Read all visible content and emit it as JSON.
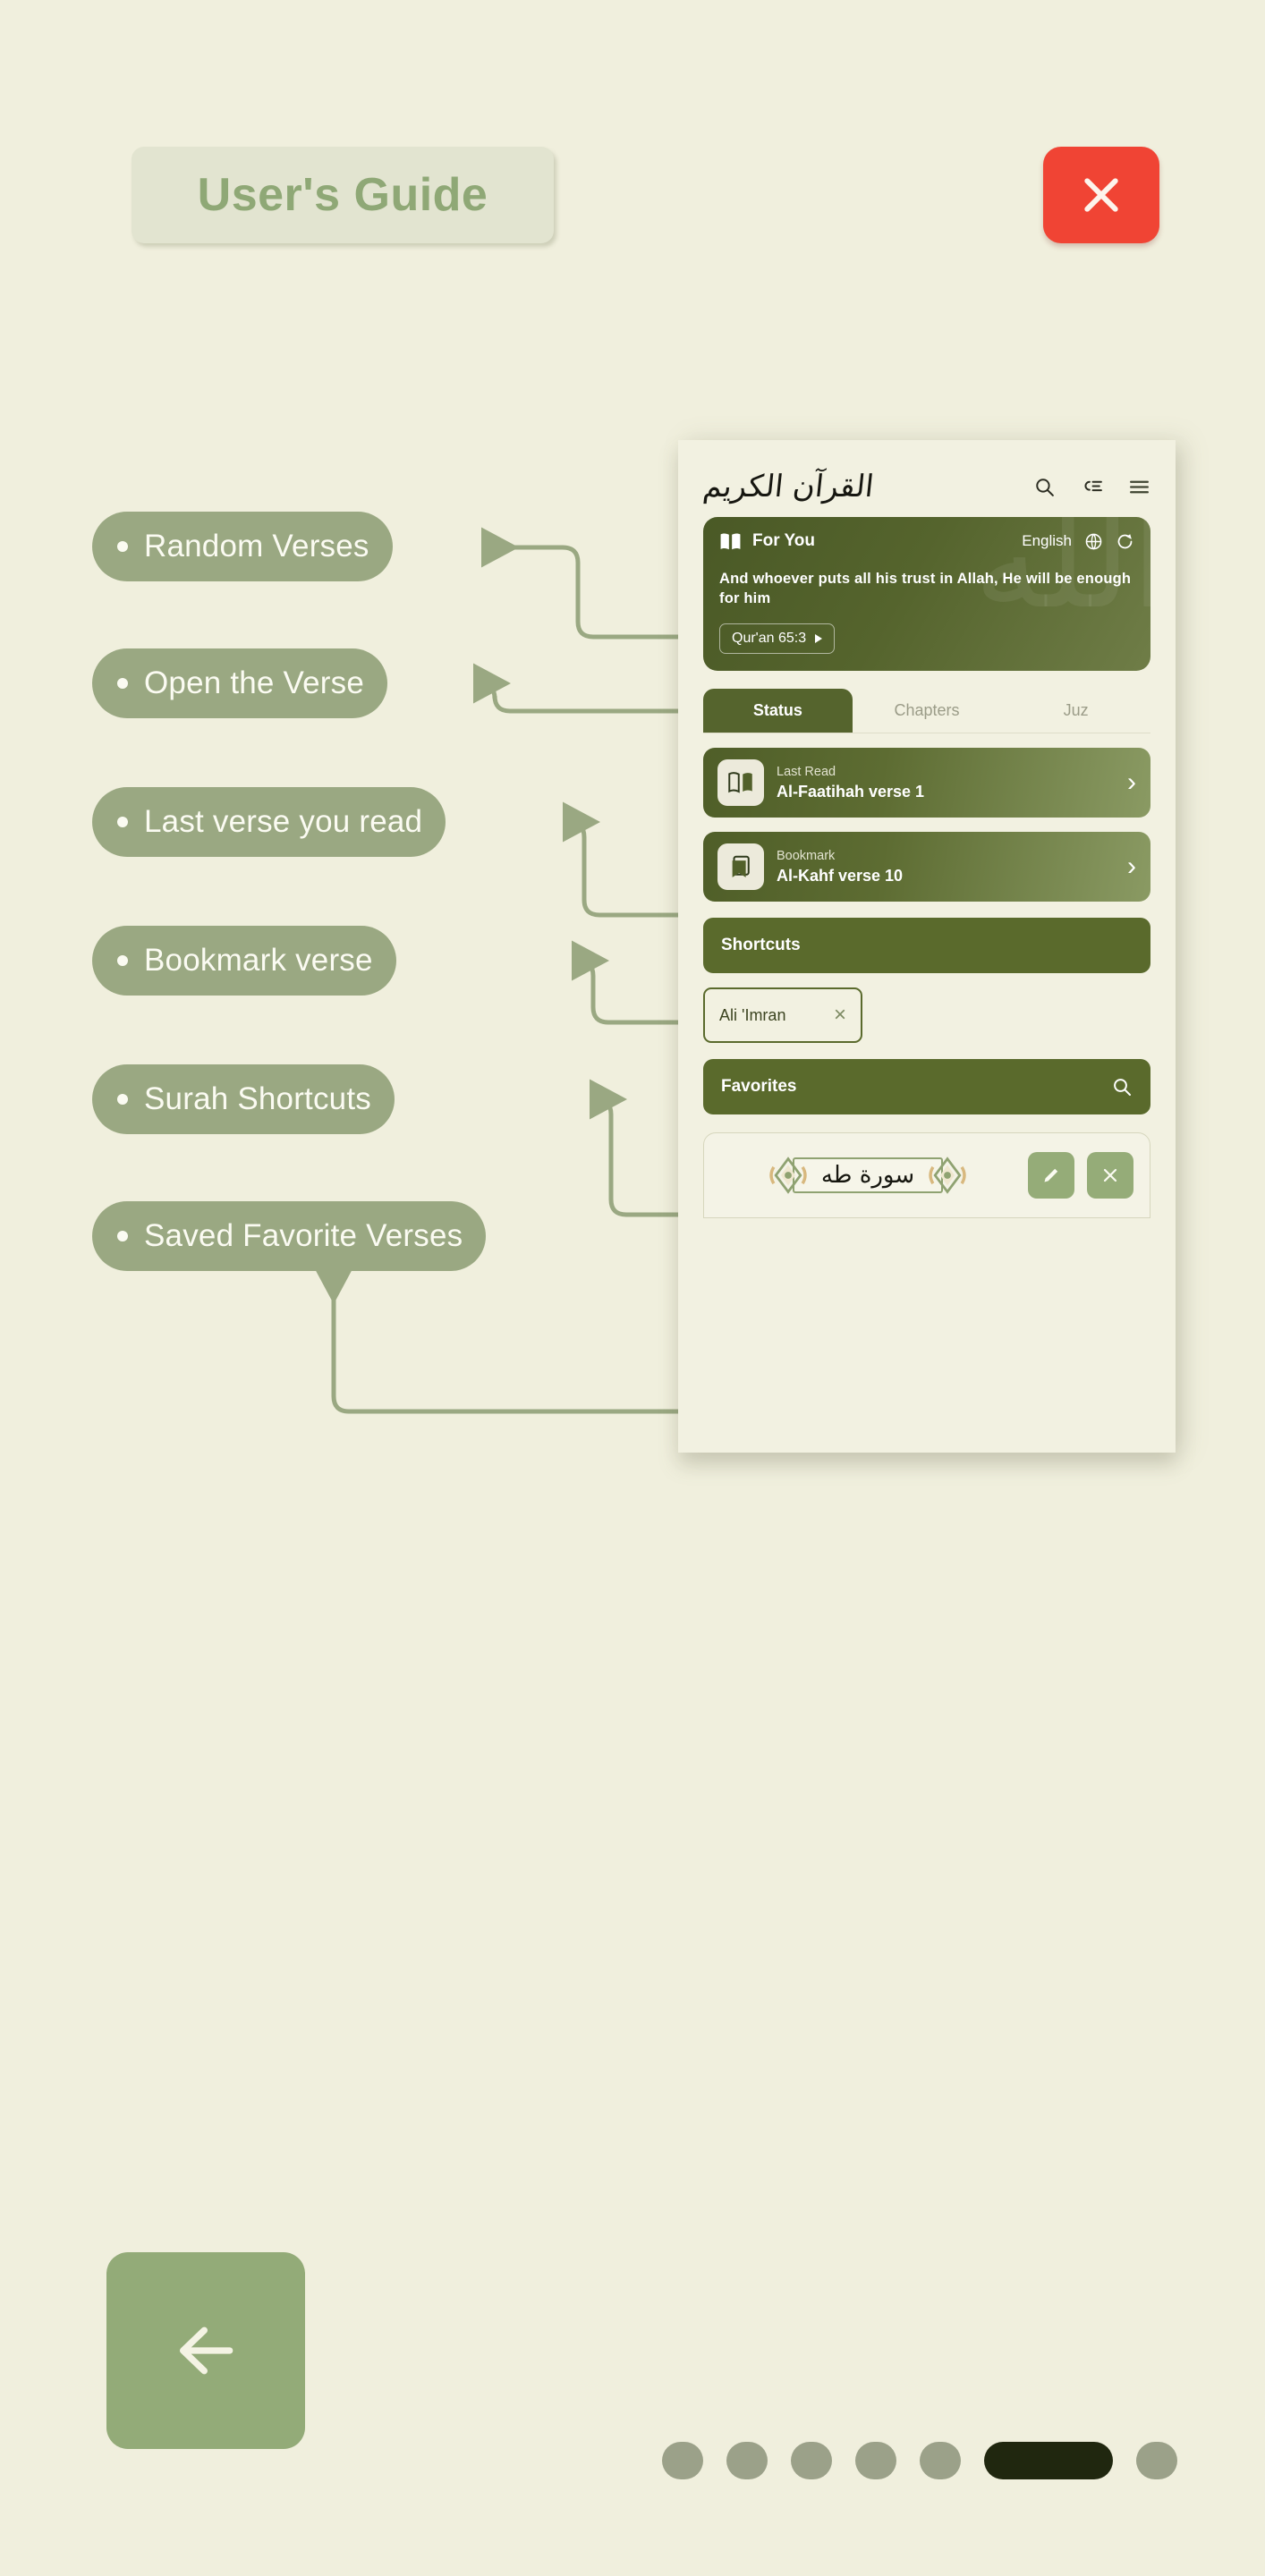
{
  "header": {
    "guide_title": "User's Guide",
    "close_icon": "close-icon"
  },
  "callouts": [
    {
      "label": "Random Verses"
    },
    {
      "label": "Open the Verse"
    },
    {
      "label": "Last verse you read"
    },
    {
      "label": "Bookmark verse"
    },
    {
      "label": "Surah Shortcuts"
    },
    {
      "label": "Saved Favorite Verses"
    }
  ],
  "phone": {
    "app_bar": {
      "logo_arabic": "القرآن الكريم",
      "icons": [
        "search-icon",
        "sort-list-icon",
        "hamburger-menu-icon"
      ]
    },
    "for_you": {
      "icon": "open-book-icon",
      "title": "For You",
      "language": "English",
      "globe_icon": "globe-icon",
      "refresh_icon": "refresh-icon",
      "verse": "And whoever puts all his trust in Allah, He will be enough for him",
      "reference": "Qur'an 65:3",
      "watermark_arabic": "الله"
    },
    "tabs": [
      {
        "label": "Status",
        "active": true
      },
      {
        "label": "Chapters",
        "active": false
      },
      {
        "label": "Juz",
        "active": false
      }
    ],
    "status_cards": [
      {
        "icon": "open-book-icon",
        "kind": "Last Read",
        "value": "Al-Faatihah verse 1",
        "chevron": "›"
      },
      {
        "icon": "bookmark-icon",
        "kind": "Bookmark",
        "value": "Al-Kahf verse 10",
        "chevron": "›"
      }
    ],
    "shortcuts_section": {
      "title": "Shortcuts"
    },
    "shortcut_chips": [
      {
        "name": "Ali 'Imran",
        "remove_icon": "close-icon",
        "remove_glyph": "×"
      }
    ],
    "favorites_section": {
      "title": "Favorites",
      "search_icon": "search-icon"
    },
    "favorite_items": [
      {
        "surah_arabic": "سورة طه",
        "edit_icon": "pencil-icon",
        "delete_icon": "close-icon"
      }
    ]
  },
  "footer": {
    "back_icon": "arrow-left-icon",
    "pagination": {
      "total": 7,
      "active_index": 5
    }
  },
  "colors": {
    "background": "#f0efdd",
    "pill": "#9aa882",
    "accent_dark_green": "#55642d",
    "close_red": "#f04434",
    "back_green": "#93ab78",
    "title_text": "#8fa876",
    "dot_inactive": "#9ba189",
    "dot_active": "#20270f",
    "connector": "#9aa882"
  }
}
